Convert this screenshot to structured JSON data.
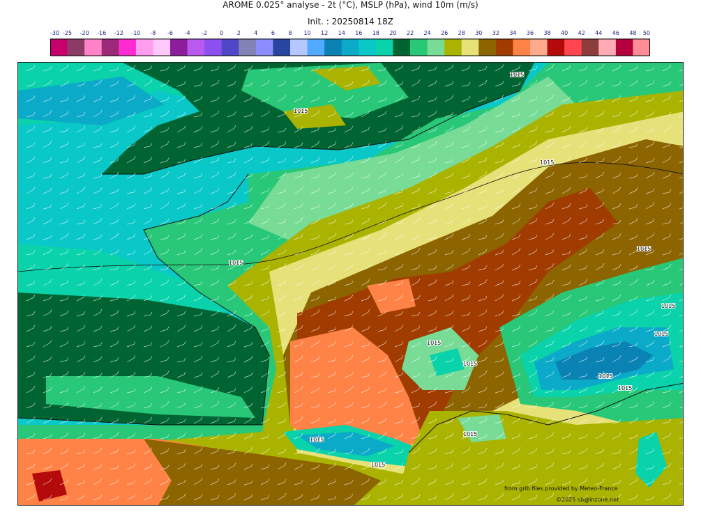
{
  "header": {
    "title": "AROME 0.025° analyse - 2t (°C), MSLP (hPa), wind 10m (m/s)",
    "init": "Init. : 20250814 18Z"
  },
  "colorbar": {
    "ticks": [
      "-30",
      "-25",
      "-20",
      "-16",
      "-12",
      "-10",
      "-8",
      "-6",
      "-4",
      "-2",
      "0",
      "2",
      "4",
      "6",
      "8",
      "10",
      "12",
      "14",
      "16",
      "18",
      "20",
      "22",
      "24",
      "26",
      "28",
      "30",
      "32",
      "34",
      "36",
      "38",
      "40",
      "42",
      "44",
      "46",
      "48",
      "50"
    ],
    "colors": [
      "#c8006c",
      "#8c3c64",
      "#ff82c8",
      "#9c2878",
      "#ff2ad2",
      "#ff9cf0",
      "#ffc8fa",
      "#8c1e9c",
      "#b85af0",
      "#8c50f0",
      "#5046c8",
      "#8282b4",
      "#8c8cff",
      "#2846a0",
      "#b4c8ff",
      "#50aaff",
      "#0a82b4",
      "#0aaac8",
      "#0ac8c8",
      "#0ad2aa",
      "#006432",
      "#28c878",
      "#78dc96",
      "#aab400",
      "#e6e178",
      "#8c6400",
      "#a03c00",
      "#ff8246",
      "#ffaa8c",
      "#b40a0a",
      "#ff4650",
      "#8c3c3c",
      "#ffaab4",
      "#b4003c",
      "#ff8c96"
    ]
  },
  "map": {
    "isobar_label": "1015",
    "palette": {
      "sea_cool": "#0ac8c8",
      "sea_teal": "#0ad2aa",
      "deep_green": "#006432",
      "mid_green": "#28c878",
      "light_green": "#78dc96",
      "olive": "#aab400",
      "khaki": "#e6e178",
      "brown": "#8c6400",
      "rust": "#a03c00",
      "orange": "#ff8246",
      "blue": "#0a82b4",
      "cyan": "#0aaac8"
    }
  },
  "credits": {
    "source": "from grib files provided by Meteo-France",
    "copyright": "©2025 sb@inzone.net"
  }
}
